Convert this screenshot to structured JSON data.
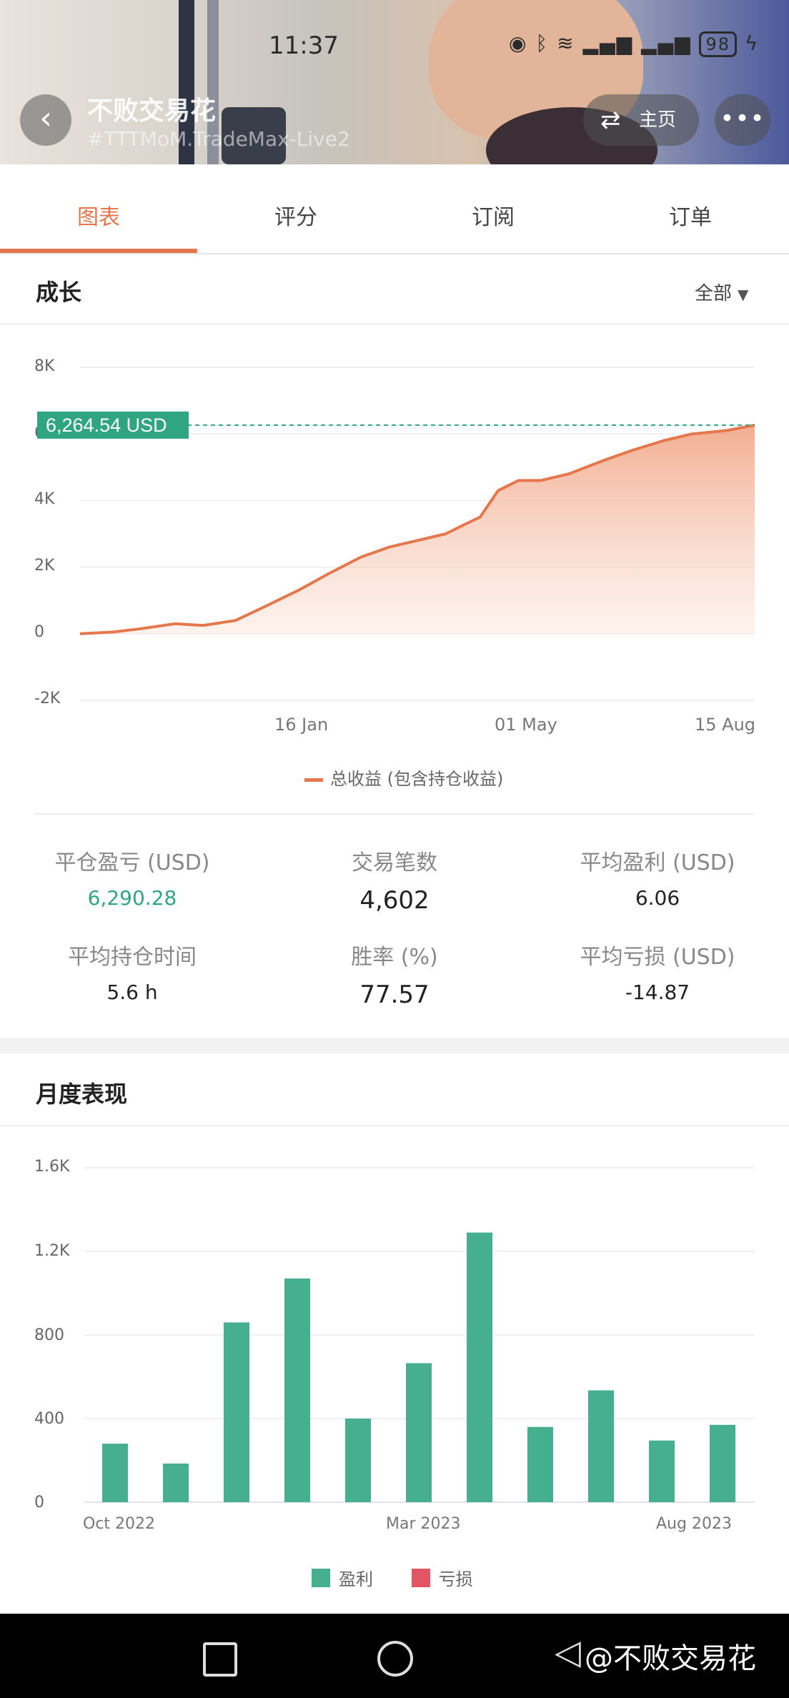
{
  "status": {
    "time": "11:37",
    "battery": "98"
  },
  "header": {
    "account_name": "不败交易花",
    "account_sub": "#TTTMoM.TradeMax-Live2",
    "home_label": "主页",
    "more_label": "•••"
  },
  "tabs": [
    {
      "label": "图表",
      "active": true
    },
    {
      "label": "评分",
      "active": false
    },
    {
      "label": "订阅",
      "active": false
    },
    {
      "label": "订单",
      "active": false
    }
  ],
  "growth": {
    "title": "成长",
    "filter": "全部",
    "current_value_label": "6,264.54 USD",
    "legend_label": "总收益 (包含持仓收益)",
    "y_ticks": [
      "8K",
      "6K",
      "4K",
      "2K",
      "0",
      "-2K"
    ],
    "x_ticks": [
      "16 Jan",
      "01 May",
      "15 Aug"
    ]
  },
  "stats": {
    "closed_pnl_label": "平仓盈亏 (USD)",
    "closed_pnl_value": "6,290.28",
    "trades_label": "交易笔数",
    "trades_value": "4,602",
    "avg_profit_label": "平均盈利 (USD)",
    "avg_profit_value": "6.06",
    "avg_hold_label": "平均持仓时间",
    "avg_hold_value": "5.6 h",
    "win_rate_label": "胜率 (%)",
    "win_rate_value": "77.57",
    "avg_loss_label": "平均亏损 (USD)",
    "avg_loss_value": "-14.87"
  },
  "monthly": {
    "title": "月度表现",
    "y_ticks": [
      "1.6K",
      "1.2K",
      "800",
      "400",
      "0"
    ],
    "x_ticks": [
      "Oct 2022",
      "Mar 2023",
      "Aug 2023"
    ],
    "legend_profit": "盈利",
    "legend_loss": "亏损"
  },
  "watermark": "@不败交易花",
  "colors": {
    "accent": "#e5774c",
    "profit": "#46b08e",
    "loss": "#e25563",
    "badge": "#2fa67f"
  },
  "chart_data": [
    {
      "type": "area",
      "title": "成长",
      "series": [
        {
          "name": "总收益 (包含持仓收益)",
          "x": [
            "2022-09-15",
            "2022-10-01",
            "2022-10-15",
            "2022-11-01",
            "2022-11-15",
            "2022-12-01",
            "2022-12-15",
            "2023-01-01",
            "2023-01-16",
            "2023-02-01",
            "2023-02-15",
            "2023-03-01",
            "2023-03-15",
            "2023-03-25",
            "2023-04-01",
            "2023-04-10",
            "2023-04-20",
            "2023-05-01",
            "2023-05-15",
            "2023-06-01",
            "2023-06-15",
            "2023-07-01",
            "2023-07-15",
            "2023-08-01",
            "2023-08-15"
          ],
          "values": [
            0,
            50,
            150,
            300,
            250,
            400,
            800,
            1300,
            1800,
            2300,
            2600,
            2800,
            3000,
            3300,
            3500,
            4300,
            4600,
            4600,
            4800,
            5200,
            5500,
            5800,
            6000,
            6100,
            6264.54
          ]
        }
      ],
      "xlabel": "",
      "ylabel": "",
      "ylim": [
        -2000,
        8000
      ],
      "x_ticks": [
        "16 Jan",
        "01 May",
        "15 Aug"
      ],
      "grid": true,
      "legend": "bottom"
    },
    {
      "type": "bar",
      "title": "月度表现",
      "categories": [
        "Oct 2022",
        "Nov 2022",
        "Dec 2022",
        "Jan 2023",
        "Feb 2023",
        "Mar 2023",
        "Apr 2023",
        "May 2023",
        "Jun 2023",
        "Jul 2023",
        "Aug 2023",
        "Sep 2023"
      ],
      "series": [
        {
          "name": "盈利",
          "values": [
            280,
            185,
            860,
            1070,
            400,
            665,
            1290,
            360,
            535,
            295,
            370,
            0
          ]
        },
        {
          "name": "亏损",
          "values": [
            0,
            0,
            0,
            0,
            0,
            0,
            0,
            0,
            0,
            0,
            0,
            0
          ]
        }
      ],
      "xlabel": "",
      "ylabel": "",
      "ylim": [
        0,
        1600
      ],
      "x_ticks": [
        "Oct 2022",
        "Mar 2023",
        "Aug 2023"
      ],
      "grid": true,
      "legend": "bottom"
    }
  ]
}
